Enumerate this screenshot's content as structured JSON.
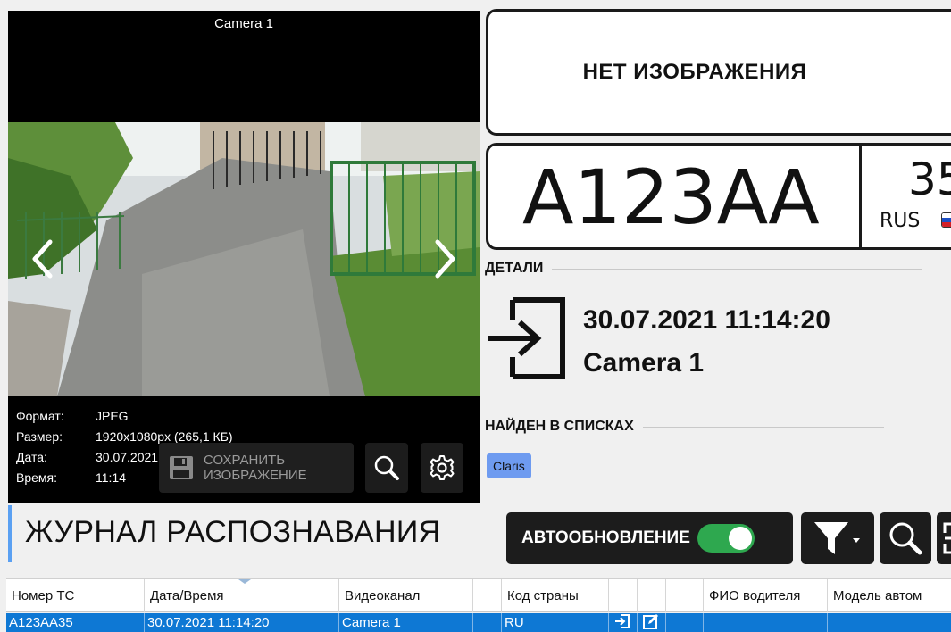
{
  "viewer": {
    "camera_title": "Camera 1",
    "info": [
      {
        "key": "Формат:",
        "value": "JPEG"
      },
      {
        "key": "Размер:",
        "value": "1920x1080px (265,1 КБ)"
      },
      {
        "key": "Дата:",
        "value": "30.07.2021"
      },
      {
        "key": "Время:",
        "value": "11:14"
      }
    ],
    "save_label_1": "СОХРАНИТЬ",
    "save_label_2": "ИЗОБРАЖЕНИЕ",
    "icons": [
      "chevron-left-icon",
      "chevron-right-icon",
      "save-icon",
      "zoom-icon",
      "settings-icon"
    ]
  },
  "plate_panel": {
    "no_image": "НЕТ ИЗОБРАЖЕНИЯ",
    "plate_number": "А123АА",
    "plate_region": "35",
    "plate_country": "RUS",
    "flag_colors": [
      "#ffffff",
      "#1c4fc4",
      "#d21f27"
    ]
  },
  "details": {
    "heading": "ДЕТАЛИ",
    "datetime": "30.07.2021 11:14:20",
    "camera": "Camera 1",
    "direction_icon": "enter-icon"
  },
  "lists": {
    "heading": "НАЙДЕН В СПИСКАХ",
    "tags": [
      "Claris"
    ]
  },
  "journal": {
    "title": "ЖУРНАЛ РАСПОЗНАВАНИЯ",
    "autoupdate_label": "АВТООБНОВЛЕНИЕ",
    "autoupdate_on": true,
    "accent_color": "#5aa0f2",
    "toggle_color": "#2ea84f"
  },
  "table": {
    "columns": [
      "Номер ТС",
      "Дата/Время",
      "Видеоканал",
      "",
      "Код страны",
      "",
      "",
      "",
      "ФИО водителя",
      "Модель автом"
    ],
    "rows": [
      {
        "plate": "A123AA35",
        "datetime": "30.07.2021 11:14:20",
        "channel": "Camera 1",
        "country": "RU"
      }
    ],
    "selected_color": "#0e78d4"
  }
}
